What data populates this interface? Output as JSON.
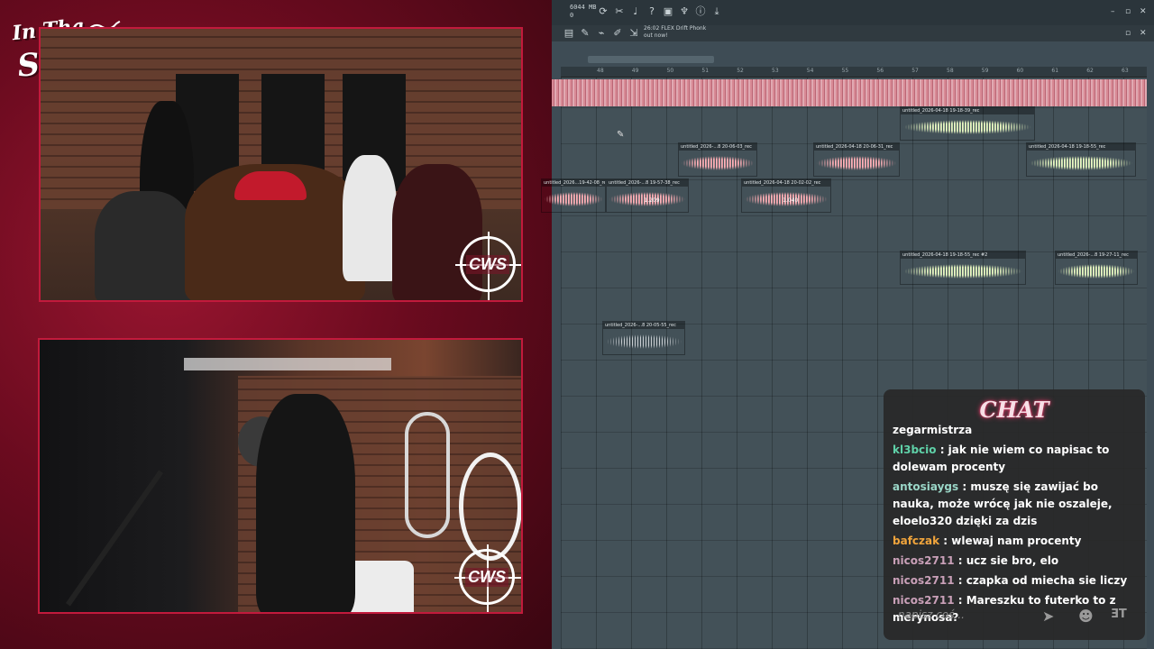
{
  "overlay": {
    "logo_line1": "In Tha",
    "logo_line2": "Studio!",
    "cws_label": "CWS"
  },
  "daw": {
    "memory": "6044 MB",
    "memory2": "0",
    "hint_time": "26:02",
    "hint_title": "FLEX Drift Phonk",
    "hint_sub": "out now!",
    "ruler": [
      "48",
      "49",
      "50",
      "51",
      "52",
      "53",
      "54",
      "55",
      "56",
      "57",
      "58",
      "59",
      "60",
      "61",
      "62",
      "63"
    ],
    "clips": [
      {
        "title": "untitled_2026-04-18 19-18-39_rec",
        "color": "green"
      },
      {
        "title": "untitled_2026-...8 20-06-03_rec",
        "color": "pink"
      },
      {
        "title": "untitled_2026-04-18 20-06-31_rec",
        "color": "pink"
      },
      {
        "title": "untitled_2026-04-18 19-18-55_rec",
        "color": "green"
      },
      {
        "title": "untitled_2026...19-42-08_re",
        "color": "pink"
      },
      {
        "title": "untitled_2026-...8 19-57-38_rec",
        "color": "pink",
        "num": "1.209"
      },
      {
        "title": "untitled_2026-04-18 20-02-02_rec",
        "color": "pink",
        "num": "1.040"
      },
      {
        "title": "untitled_2026-04-18 19-18-55_rec #2",
        "color": "green"
      },
      {
        "title": "untitled_2026-...8 19-27-11_rec",
        "color": "green"
      },
      {
        "title": "untitled_2026-...8 20-05-55_rec",
        "color": "grey"
      }
    ]
  },
  "chat": {
    "title": "CHAT",
    "input_placeholder": "napisz coś...",
    "messages": [
      {
        "user": "",
        "text": "zegarmistrza",
        "color": "#ffffff"
      },
      {
        "user": "kl3bcio",
        "text": " : jak nie wiem co napisac to dolewam procenty",
        "color": "#5fd1a8"
      },
      {
        "user": "antosiaygs",
        "text": " : muszę się zawijać bo nauka, może wrócę jak nie oszaleje, eloelo320 dzięki za dzis",
        "color": "#9ad6c7"
      },
      {
        "user": "bafczak",
        "text": " : wlewaj nam procenty",
        "color": "#f0a43c"
      },
      {
        "user": "nicos2711",
        "text": " : ucz sie bro, elo",
        "color": "#c9a0b8"
      },
      {
        "user": "nicos2711",
        "text": " : czapka od miecha sie liczy",
        "color": "#c9a0b8"
      },
      {
        "user": "nicos2711",
        "text": " : Mareszku to futerko to z merynosa?",
        "color": "#c9a0b8"
      }
    ]
  }
}
